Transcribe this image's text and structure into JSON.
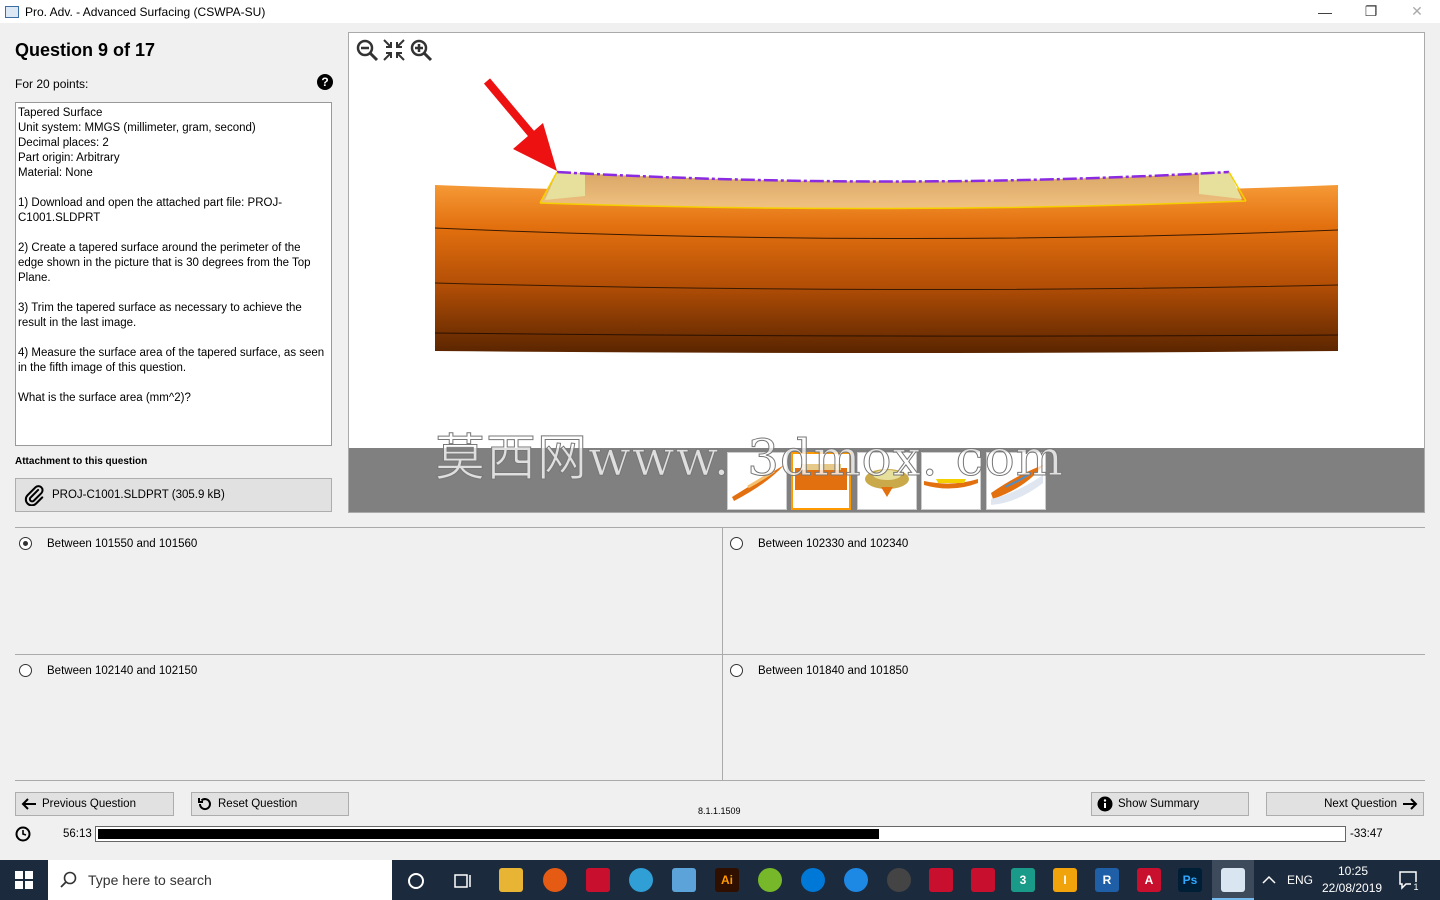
{
  "window": {
    "title": "Pro. Adv. - Advanced Surfacing (CSWPA-SU)",
    "minimize_glyph": "—",
    "restore_glyph": "❐",
    "close_glyph": "✕"
  },
  "question": {
    "heading": "Question 9 of 17",
    "points": "For 20 points:",
    "help_glyph": "?",
    "text": "Tapered Surface\nUnit system: MMGS (millimeter, gram, second)\nDecimal places: 2\nPart origin: Arbitrary\nMaterial: None\n\n1) Download and open the attached part file: PROJ-\nC1001.SLDPRT\n\n2) Create a tapered surface around the perimeter of the\nedge shown in the picture that is 30 degrees from the Top\nPlane.\n\n3) Trim the tapered surface as necessary to achieve the\nresult in the last image.\n\n4) Measure the surface area of the tapered surface, as seen\nin the fifth image of this question.\n\nWhat is the surface area (mm^2)?"
  },
  "attachment": {
    "label": "Attachment to this question",
    "file": "PROJ-C1001.SLDPRT (305.9 kB)"
  },
  "viewer": {
    "watermark": "莫西网www. 3dmox. com",
    "thumbnails": 5,
    "active_thumbnail": 2
  },
  "answers": [
    {
      "label": "Between 101550 and 101560",
      "selected": true
    },
    {
      "label": "Between 102330 and 102340",
      "selected": false
    },
    {
      "label": "Between 102140 and 102150",
      "selected": false
    },
    {
      "label": "Between 101840 and 101850",
      "selected": false
    }
  ],
  "buttons": {
    "previous": "Previous Question",
    "reset": "Reset Question",
    "summary": "Show Summary",
    "next": "Next Question"
  },
  "version": "8.1.1.1509",
  "timer": {
    "elapsed": "56:13",
    "remaining": "-33:47",
    "progress": 0.627
  },
  "taskbar": {
    "search_placeholder": "Type here to search",
    "language": "ENG",
    "time": "10:25",
    "date": "22/08/2019",
    "notification_count": "1",
    "tb_icon_labels": [
      "Ai",
      "3",
      "I",
      "R",
      "A",
      "Ps"
    ]
  },
  "colors": {
    "accent_active_thumb": "#ff9900",
    "kayak_orange": "#e8760e",
    "taskbar": "#1c2a3d"
  }
}
